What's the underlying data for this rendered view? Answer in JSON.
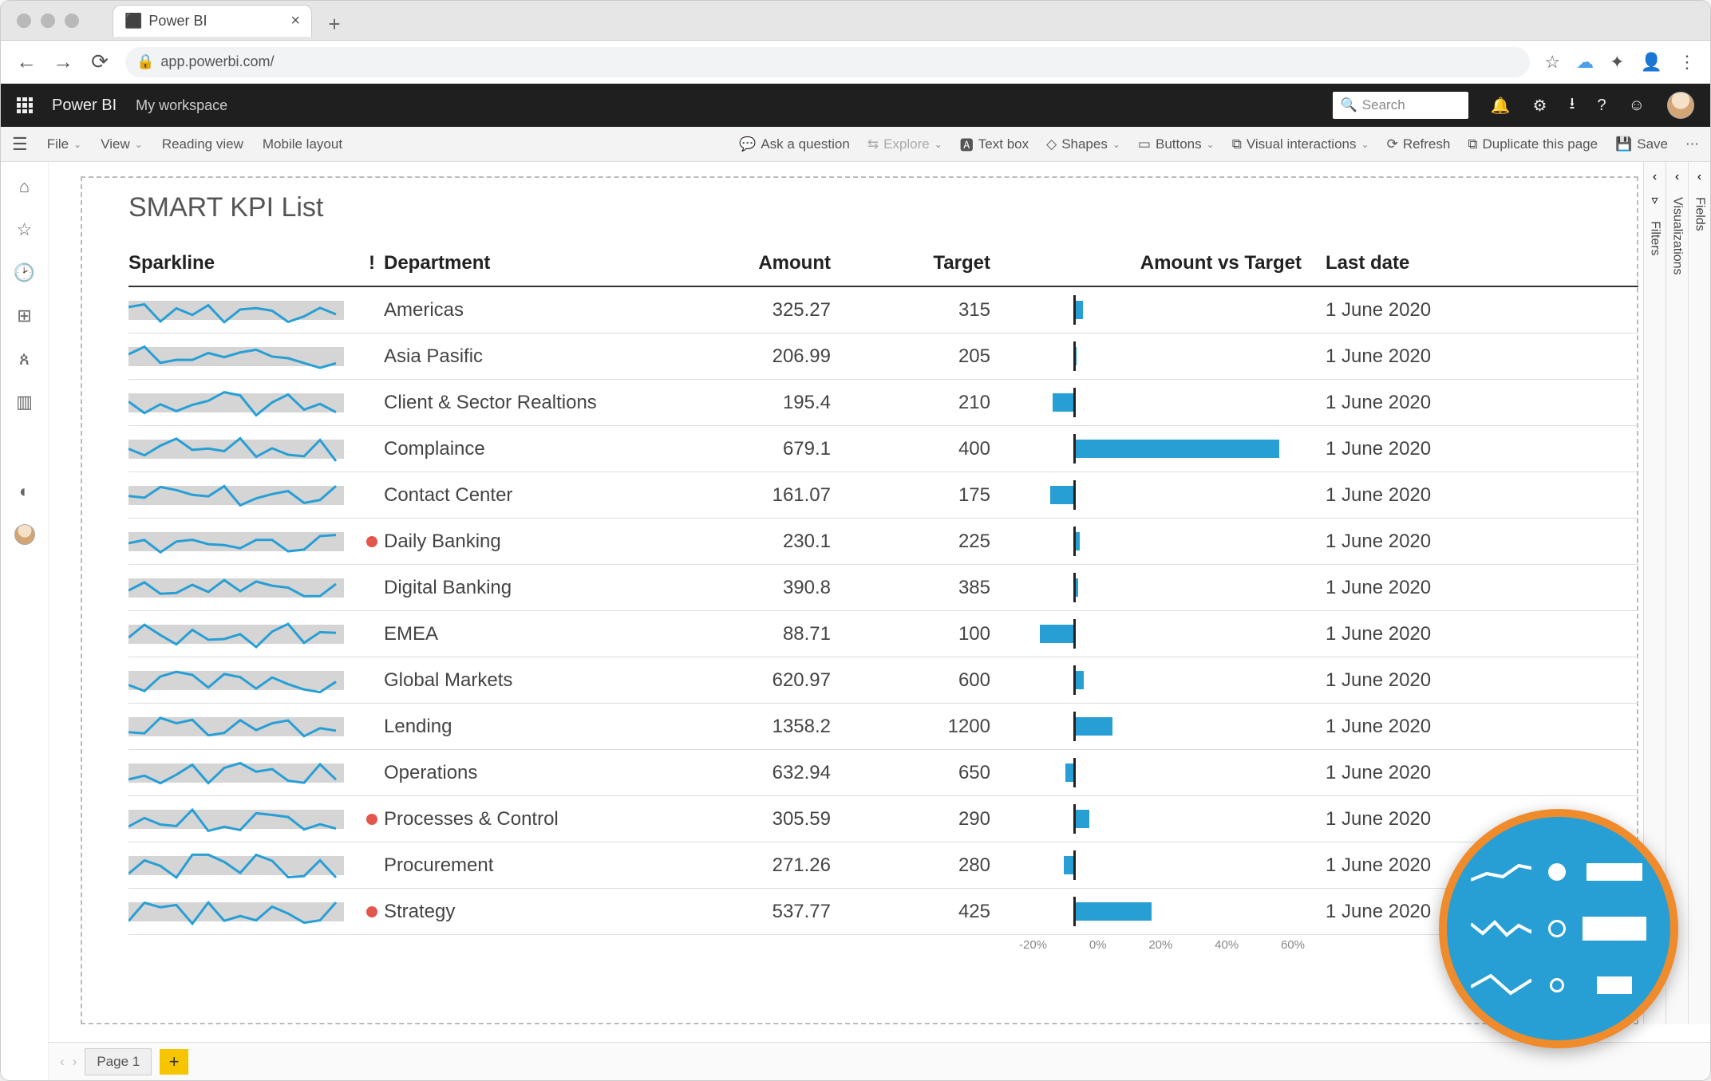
{
  "browser": {
    "tab_title": "Power BI",
    "url": "app.powerbi.com/"
  },
  "pbi_header": {
    "brand": "Power BI",
    "workspace": "My workspace",
    "search_placeholder": "Search"
  },
  "ribbon": {
    "left": {
      "file": "File",
      "view": "View",
      "reading": "Reading view",
      "mobile": "Mobile layout"
    },
    "right": {
      "ask": "Ask a question",
      "explore": "Explore",
      "textbox": "Text box",
      "shapes": "Shapes",
      "buttons": "Buttons",
      "visual_interactions": "Visual interactions",
      "refresh": "Refresh",
      "duplicate": "Duplicate this page",
      "save": "Save"
    }
  },
  "right_panels": {
    "filters": "Filters",
    "visualizations": "Visualizations",
    "fields": "Fields"
  },
  "pagebar": {
    "page1": "Page 1"
  },
  "report": {
    "title": "SMART KPI List",
    "columns": {
      "sparkline": "Sparkline",
      "alert": "!",
      "department": "Department",
      "amount": "Amount",
      "target": "Target",
      "vs": "Amount vs Target",
      "last_date": "Last date"
    },
    "axis_ticks": [
      "-20%",
      "0%",
      "20%",
      "40%",
      "60%"
    ],
    "rows": [
      {
        "department": "Americas",
        "amount": "325.27",
        "target": "315",
        "alert": false,
        "date": "1 June 2020"
      },
      {
        "department": "Asia Pasific",
        "amount": "206.99",
        "target": "205",
        "alert": false,
        "date": "1 June 2020"
      },
      {
        "department": "Client & Sector Realtions",
        "amount": "195.4",
        "target": "210",
        "alert": false,
        "date": "1 June 2020"
      },
      {
        "department": "Complaince",
        "amount": "679.1",
        "target": "400",
        "alert": false,
        "date": "1 June 2020"
      },
      {
        "department": "Contact Center",
        "amount": "161.07",
        "target": "175",
        "alert": false,
        "date": "1 June 2020"
      },
      {
        "department": "Daily Banking",
        "amount": "230.1",
        "target": "225",
        "alert": false,
        "date": "1 June 2020",
        "red": true
      },
      {
        "department": "Digital Banking",
        "amount": "390.8",
        "target": "385",
        "alert": false,
        "date": "1 June 2020"
      },
      {
        "department": "EMEA",
        "amount": "88.71",
        "target": "100",
        "alert": false,
        "date": "1 June 2020"
      },
      {
        "department": "Global Markets",
        "amount": "620.97",
        "target": "600",
        "alert": false,
        "date": "1 June 2020"
      },
      {
        "department": "Lending",
        "amount": "1358.2",
        "target": "1200",
        "alert": false,
        "date": "1 June 2020"
      },
      {
        "department": "Operations",
        "amount": "632.94",
        "target": "650",
        "alert": false,
        "date": "1 June 2020"
      },
      {
        "department": "Processes & Control",
        "amount": "305.59",
        "target": "290",
        "alert": false,
        "date": "1 June 2020",
        "red": true
      },
      {
        "department": "Procurement",
        "amount": "271.26",
        "target": "280",
        "alert": false,
        "date": "1 June 2020"
      },
      {
        "department": "Strategy",
        "amount": "537.77",
        "target": "425",
        "alert": false,
        "date": "1 June 2020",
        "red": true
      }
    ]
  },
  "chart_data": {
    "type": "table",
    "title": "SMART KPI List",
    "columns": [
      "Department",
      "Amount",
      "Target",
      "Amount vs Target %",
      "Last date"
    ],
    "x_axis_range_pct": [
      -20,
      80
    ],
    "series": [
      {
        "department": "Americas",
        "amount": 325.27,
        "target": 315,
        "pct_vs_target": 3.26,
        "last_date": "2020-06-01"
      },
      {
        "department": "Asia Pasific",
        "amount": 206.99,
        "target": 205,
        "pct_vs_target": 0.97,
        "last_date": "2020-06-01"
      },
      {
        "department": "Client & Sector Realtions",
        "amount": 195.4,
        "target": 210,
        "pct_vs_target": -6.95,
        "last_date": "2020-06-01"
      },
      {
        "department": "Complaince",
        "amount": 679.1,
        "target": 400,
        "pct_vs_target": 69.78,
        "last_date": "2020-06-01"
      },
      {
        "department": "Contact Center",
        "amount": 161.07,
        "target": 175,
        "pct_vs_target": -7.96,
        "last_date": "2020-06-01"
      },
      {
        "department": "Daily Banking",
        "amount": 230.1,
        "target": 225,
        "pct_vs_target": 2.27,
        "last_date": "2020-06-01"
      },
      {
        "department": "Digital Banking",
        "amount": 390.8,
        "target": 385,
        "pct_vs_target": 1.51,
        "last_date": "2020-06-01"
      },
      {
        "department": "EMEA",
        "amount": 88.71,
        "target": 100,
        "pct_vs_target": -11.29,
        "last_date": "2020-06-01"
      },
      {
        "department": "Global Markets",
        "amount": 620.97,
        "target": 600,
        "pct_vs_target": 3.5,
        "last_date": "2020-06-01"
      },
      {
        "department": "Lending",
        "amount": 1358.2,
        "target": 1200,
        "pct_vs_target": 13.18,
        "last_date": "2020-06-01"
      },
      {
        "department": "Operations",
        "amount": 632.94,
        "target": 650,
        "pct_vs_target": -2.62,
        "last_date": "2020-06-01"
      },
      {
        "department": "Processes & Control",
        "amount": 305.59,
        "target": 290,
        "pct_vs_target": 5.38,
        "last_date": "2020-06-01"
      },
      {
        "department": "Procurement",
        "amount": 271.26,
        "target": 280,
        "pct_vs_target": -3.12,
        "last_date": "2020-06-01"
      },
      {
        "department": "Strategy",
        "amount": 537.77,
        "target": 425,
        "pct_vs_target": 26.53,
        "last_date": "2020-06-01"
      }
    ]
  }
}
